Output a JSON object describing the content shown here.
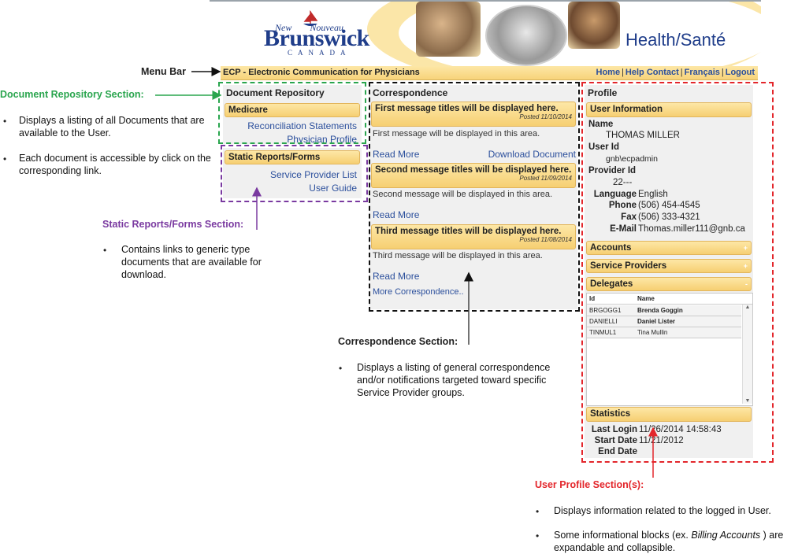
{
  "header": {
    "logo_new": "New",
    "logo_nouveau": "Nouveau",
    "logo_main": "Brunswick",
    "logo_canada": "CANADA",
    "health_label": "Health/Santé"
  },
  "menubar": {
    "title": "ECP - Electronic Communication for Physicians",
    "links": [
      "Home",
      "Help Contact",
      "Français",
      "Logout"
    ],
    "separator": "|"
  },
  "document_repository": {
    "heading": "Document Repository",
    "group": "Medicare",
    "links": [
      "Reconciliation Statements",
      "Physician Profile"
    ]
  },
  "static_reports": {
    "heading": "Static Reports/Forms",
    "links": [
      "Service Provider List",
      "User Guide"
    ]
  },
  "correspondence": {
    "heading": "Correspondence",
    "messages": [
      {
        "title": "First message titles will be displayed here.",
        "posted": "Posted 11/10/2014",
        "body": "First message will be displayed in this area.",
        "read_more": "Read More",
        "download": "Download Document"
      },
      {
        "title": "Second message titles will be displayed here.",
        "posted": "Posted 11/09/2014",
        "body": "Second message will be displayed in this area.",
        "read_more": "Read More",
        "download": ""
      },
      {
        "title": "Third message titles will be displayed here.",
        "posted": "Posted 11/08/2014",
        "body": "Third message will be displayed in this area.",
        "read_more": "Read More",
        "download": ""
      }
    ],
    "more": "More Correspondence.."
  },
  "profile": {
    "heading": "Profile",
    "user_info_title": "User Information",
    "name_label": "Name",
    "name_value": "THOMAS MILLER",
    "userid_label": "User Id",
    "userid_value": "gnb\\ecpadmin",
    "provider_label": "Provider Id",
    "provider_value": "22---",
    "language_label": "Language",
    "language_value": "English",
    "phone_label": "Phone",
    "phone_value": "(506) 454-4545",
    "fax_label": "Fax",
    "fax_value": "(506) 333-4321",
    "email_label": "E-Mail",
    "email_value": "Thomas.miller111@gnb.ca",
    "accounts_title": "Accounts",
    "service_providers_title": "Service Providers",
    "delegates_title": "Delegates",
    "expand_symbol": "+",
    "collapse_symbol": "-",
    "delegates_columns": [
      "Id",
      "Name"
    ],
    "delegates": [
      {
        "id": "BRGOGG1",
        "name": "Brenda Goggin"
      },
      {
        "id": "DANIELLI",
        "name": "Daniel Lister"
      },
      {
        "id": "TINMUL1",
        "name": "Tina Mullin"
      }
    ],
    "statistics_title": "Statistics",
    "last_login_label": "Last Login",
    "last_login_value": "11/26/2014 14:58:43",
    "start_date_label": "Start Date",
    "start_date_value": "11/21/2012",
    "end_date_label": "End Date",
    "end_date_value": ""
  },
  "annotations": {
    "menu_bar": "Menu Bar",
    "doc_repo_title": "Document Repository Section:",
    "doc_repo_b1": "Displays a listing of all Documents that are available to the User.",
    "doc_repo_b2": "Each document is accessible by click on the corresponding link.",
    "static_title": "Static Reports/Forms Section:",
    "static_b1": "Contains links to generic type documents that are available for download.",
    "corr_title": "Correspondence Section:",
    "corr_b1": "Displays a listing of general correspondence and/or notifications targeted toward specific Service Provider groups.",
    "profile_title": "User Profile Section(s):",
    "profile_b1": "Displays information related to the logged in User.",
    "profile_b2_pre": "Some informational blocks (ex. ",
    "profile_b2_em": "Billing Accounts",
    "profile_b2_post": " ) are expandable and collapsible.",
    "bullet": "•",
    "colors": {
      "green": "#2aa54e",
      "purple": "#7a3aa0",
      "red": "#e3262b",
      "black": "#111111"
    }
  }
}
